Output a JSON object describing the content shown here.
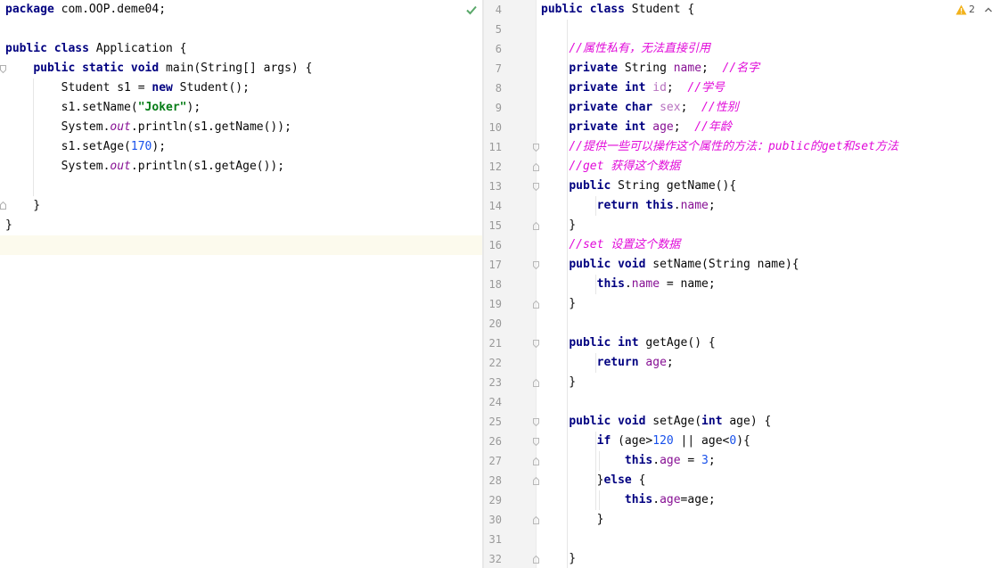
{
  "left_editor": {
    "lines": [
      [
        {
          "t": "kw",
          "v": "package"
        },
        {
          "t": "",
          "v": " com.OOP.deme04;"
        }
      ],
      [],
      [
        {
          "t": "kw",
          "v": "public"
        },
        {
          "t": "",
          "v": " "
        },
        {
          "t": "kw",
          "v": "class"
        },
        {
          "t": "",
          "v": " Application {"
        }
      ],
      [
        {
          "t": "",
          "v": "    "
        },
        {
          "t": "kw",
          "v": "public"
        },
        {
          "t": "",
          "v": " "
        },
        {
          "t": "kw",
          "v": "static"
        },
        {
          "t": "",
          "v": " "
        },
        {
          "t": "kw",
          "v": "void"
        },
        {
          "t": "",
          "v": " main(String[] args) {"
        }
      ],
      [
        {
          "t": "",
          "v": "        Student s1 = "
        },
        {
          "t": "kw",
          "v": "new"
        },
        {
          "t": "",
          "v": " Student();"
        }
      ],
      [
        {
          "t": "",
          "v": "        s1.setName("
        },
        {
          "t": "str",
          "v": "\"Joker\""
        },
        {
          "t": "",
          "v": ");"
        }
      ],
      [
        {
          "t": "",
          "v": "        System."
        },
        {
          "t": "static",
          "v": "out"
        },
        {
          "t": "",
          "v": ".println(s1.getName());"
        }
      ],
      [
        {
          "t": "",
          "v": "        s1.setAge("
        },
        {
          "t": "num",
          "v": "170"
        },
        {
          "t": "",
          "v": ");"
        }
      ],
      [
        {
          "t": "",
          "v": "        System."
        },
        {
          "t": "static",
          "v": "out"
        },
        {
          "t": "",
          "v": ".println(s1.getAge());"
        }
      ],
      [],
      [
        {
          "t": "",
          "v": "    }"
        }
      ],
      [
        {
          "t": "",
          "v": "}"
        }
      ]
    ]
  },
  "right_editor": {
    "line_numbers": [
      "4",
      "5",
      "6",
      "7",
      "8",
      "9",
      "10",
      "11",
      "12",
      "13",
      "14",
      "15",
      "16",
      "17",
      "18",
      "19",
      "20",
      "21",
      "22",
      "23",
      "24",
      "25",
      "26",
      "27",
      "28",
      "29",
      "30",
      "31",
      "32"
    ],
    "lines": [
      [
        {
          "t": "kw",
          "v": "public"
        },
        {
          "t": "",
          "v": " "
        },
        {
          "t": "kw",
          "v": "class"
        },
        {
          "t": "",
          "v": " Student {"
        }
      ],
      [],
      [
        {
          "t": "",
          "v": "    "
        },
        {
          "t": "cm",
          "v": "//属性私有，无法直接引用"
        }
      ],
      [
        {
          "t": "",
          "v": "    "
        },
        {
          "t": "kw",
          "v": "private"
        },
        {
          "t": "",
          "v": " String "
        },
        {
          "t": "fld",
          "v": "name"
        },
        {
          "t": "",
          "v": ";  "
        },
        {
          "t": "cm",
          "v": "//名字"
        }
      ],
      [
        {
          "t": "",
          "v": "    "
        },
        {
          "t": "kw",
          "v": "private"
        },
        {
          "t": "",
          "v": " "
        },
        {
          "t": "kw",
          "v": "int"
        },
        {
          "t": "",
          "v": " "
        },
        {
          "t": "fldg",
          "v": "id"
        },
        {
          "t": "",
          "v": ";  "
        },
        {
          "t": "cm",
          "v": "//学号"
        }
      ],
      [
        {
          "t": "",
          "v": "    "
        },
        {
          "t": "kw",
          "v": "private"
        },
        {
          "t": "",
          "v": " "
        },
        {
          "t": "kw",
          "v": "char"
        },
        {
          "t": "",
          "v": " "
        },
        {
          "t": "fldg",
          "v": "sex"
        },
        {
          "t": "",
          "v": ";  "
        },
        {
          "t": "cm",
          "v": "//性别"
        }
      ],
      [
        {
          "t": "",
          "v": "    "
        },
        {
          "t": "kw",
          "v": "private"
        },
        {
          "t": "",
          "v": " "
        },
        {
          "t": "kw",
          "v": "int"
        },
        {
          "t": "",
          "v": " "
        },
        {
          "t": "fld",
          "v": "age"
        },
        {
          "t": "",
          "v": ";  "
        },
        {
          "t": "cm",
          "v": "//年龄"
        }
      ],
      [
        {
          "t": "",
          "v": "    "
        },
        {
          "t": "cm",
          "v": "//提供一些可以操作这个属性的方法：public的get和set方法"
        }
      ],
      [
        {
          "t": "",
          "v": "    "
        },
        {
          "t": "cm",
          "v": "//get 获得这个数据"
        }
      ],
      [
        {
          "t": "",
          "v": "    "
        },
        {
          "t": "kw",
          "v": "public"
        },
        {
          "t": "",
          "v": " String getName(){"
        }
      ],
      [
        {
          "t": "",
          "v": "        "
        },
        {
          "t": "kw",
          "v": "return"
        },
        {
          "t": "",
          "v": " "
        },
        {
          "t": "kw",
          "v": "this"
        },
        {
          "t": "",
          "v": "."
        },
        {
          "t": "fld",
          "v": "name"
        },
        {
          "t": "",
          "v": ";"
        }
      ],
      [
        {
          "t": "",
          "v": "    }"
        }
      ],
      [
        {
          "t": "",
          "v": "    "
        },
        {
          "t": "cm",
          "v": "//set 设置这个数据"
        }
      ],
      [
        {
          "t": "",
          "v": "    "
        },
        {
          "t": "kw",
          "v": "public"
        },
        {
          "t": "",
          "v": " "
        },
        {
          "t": "kw",
          "v": "void"
        },
        {
          "t": "",
          "v": " setName(String name){"
        }
      ],
      [
        {
          "t": "",
          "v": "        "
        },
        {
          "t": "kw",
          "v": "this"
        },
        {
          "t": "",
          "v": "."
        },
        {
          "t": "fld",
          "v": "name"
        },
        {
          "t": "",
          "v": " = name;"
        }
      ],
      [
        {
          "t": "",
          "v": "    }"
        }
      ],
      [],
      [
        {
          "t": "",
          "v": "    "
        },
        {
          "t": "kw",
          "v": "public"
        },
        {
          "t": "",
          "v": " "
        },
        {
          "t": "kw",
          "v": "int"
        },
        {
          "t": "",
          "v": " getAge() {"
        }
      ],
      [
        {
          "t": "",
          "v": "        "
        },
        {
          "t": "kw",
          "v": "return"
        },
        {
          "t": "",
          "v": " "
        },
        {
          "t": "fld",
          "v": "age"
        },
        {
          "t": "",
          "v": ";"
        }
      ],
      [
        {
          "t": "",
          "v": "    }"
        }
      ],
      [],
      [
        {
          "t": "",
          "v": "    "
        },
        {
          "t": "kw",
          "v": "public"
        },
        {
          "t": "",
          "v": " "
        },
        {
          "t": "kw",
          "v": "void"
        },
        {
          "t": "",
          "v": " setAge("
        },
        {
          "t": "kw",
          "v": "int"
        },
        {
          "t": "",
          "v": " age) {"
        }
      ],
      [
        {
          "t": "",
          "v": "        "
        },
        {
          "t": "kw",
          "v": "if"
        },
        {
          "t": "",
          "v": " (age>"
        },
        {
          "t": "num",
          "v": "120"
        },
        {
          "t": "",
          "v": " || age<"
        },
        {
          "t": "num",
          "v": "0"
        },
        {
          "t": "",
          "v": "){"
        }
      ],
      [
        {
          "t": "",
          "v": "            "
        },
        {
          "t": "kw",
          "v": "this"
        },
        {
          "t": "",
          "v": "."
        },
        {
          "t": "fld",
          "v": "age"
        },
        {
          "t": "",
          "v": " = "
        },
        {
          "t": "num",
          "v": "3"
        },
        {
          "t": "",
          "v": ";"
        }
      ],
      [
        {
          "t": "",
          "v": "        }"
        },
        {
          "t": "kw",
          "v": "else"
        },
        {
          "t": "",
          "v": " {"
        }
      ],
      [
        {
          "t": "",
          "v": "            "
        },
        {
          "t": "kw",
          "v": "this"
        },
        {
          "t": "",
          "v": "."
        },
        {
          "t": "fld",
          "v": "age"
        },
        {
          "t": "",
          "v": "=age;"
        }
      ],
      [
        {
          "t": "",
          "v": "        }"
        }
      ],
      [],
      [
        {
          "t": "",
          "v": "    }"
        }
      ]
    ]
  },
  "status": {
    "left_check_icon": "check-icon",
    "warning_icon": "warning-icon",
    "warning_count": "2",
    "nav_icon": "chevron-up-icon"
  },
  "colors": {
    "keyword": "#000080",
    "string": "#067d17",
    "number": "#1750eb",
    "comment": "#e10ad9",
    "field": "#871094",
    "current_line": "#fcfaed",
    "check": "#59a869",
    "warning": "#f2b21c"
  }
}
